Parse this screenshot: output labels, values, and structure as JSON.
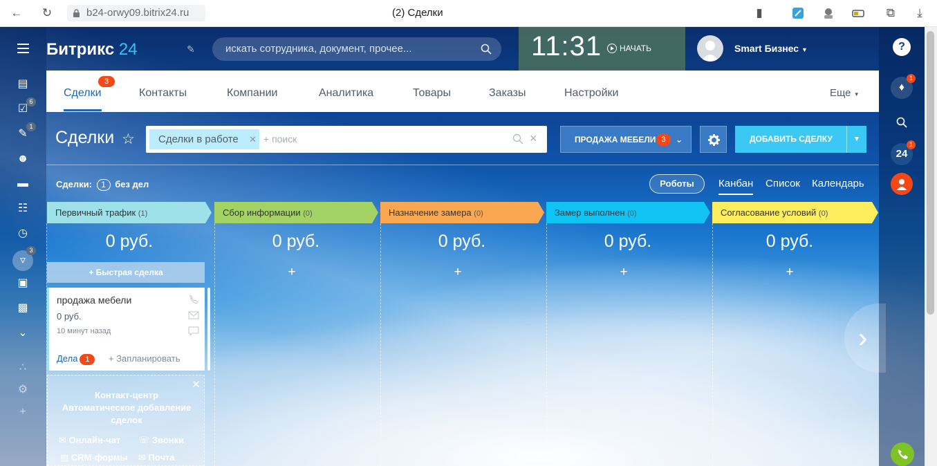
{
  "browser": {
    "url": "b24-orwy09.bitrix24.ru",
    "tab_title": "(2) Сделки"
  },
  "header": {
    "logo_text": "Битрикс",
    "logo_num": "24",
    "search_placeholder": "искать сотрудника, документ, прочее...",
    "clock": "11:31",
    "start_label": "НАЧАТЬ",
    "user_name": "Smart Бизнес"
  },
  "left_rail": {
    "badges": {
      "tasks": "6",
      "chat": "1",
      "filter": "3"
    }
  },
  "right_rail": {
    "notifications_badge": "1",
    "b24_label": "24",
    "b24_badge": "1"
  },
  "tabs": {
    "items": [
      "Сделки",
      "Контакты",
      "Компании",
      "Аналитика",
      "Товары",
      "Заказы",
      "Настройки"
    ],
    "deals_badge": "3",
    "more": "Еще"
  },
  "page": {
    "title": "Сделки",
    "filter_chip": "Сделки в работе",
    "filter_placeholder": "+ поиск",
    "pipeline_label": "ПРОДАЖА МЕБЕЛИ",
    "pipeline_badge": "3",
    "add_label": "ДОБАВИТЬ СДЕЛКУ"
  },
  "subrow": {
    "label": "Сделки:",
    "count": "1",
    "suffix": "без дел",
    "robots": "Роботы",
    "views": [
      "Канбан",
      "Список",
      "Календарь"
    ]
  },
  "columns": [
    {
      "name": "Первичный трафик",
      "count": "(1)",
      "sum": "0 руб.",
      "color": "#9ee1e8"
    },
    {
      "name": "Сбор информации",
      "count": "(0)",
      "sum": "0 руб.",
      "color": "#a4d365"
    },
    {
      "name": "Назначение замера",
      "count": "(0)",
      "sum": "0 руб.",
      "color": "#f9a851"
    },
    {
      "name": "Замер выполнен",
      "count": "(0)",
      "sum": "0 руб.",
      "color": "#10c3f2"
    },
    {
      "name": "Согласование условий",
      "count": "(0)",
      "sum": "0 руб.",
      "color": "#fbed5b"
    }
  ],
  "plus_sign": "+",
  "quick_deal": "+ Быстрая сделка",
  "deal_card": {
    "title": "продажа мебели",
    "sum": "0 руб.",
    "time": "10 минут назад",
    "tasks_label": "Дела",
    "tasks_badge": "1",
    "plan_label": "+ Запланировать"
  },
  "contact_center": {
    "title": "Контакт-центр Автоматическое добавление сделок",
    "items": [
      "Онлайн-чат",
      "Звонки",
      "CRM-формы",
      "Почта"
    ]
  }
}
